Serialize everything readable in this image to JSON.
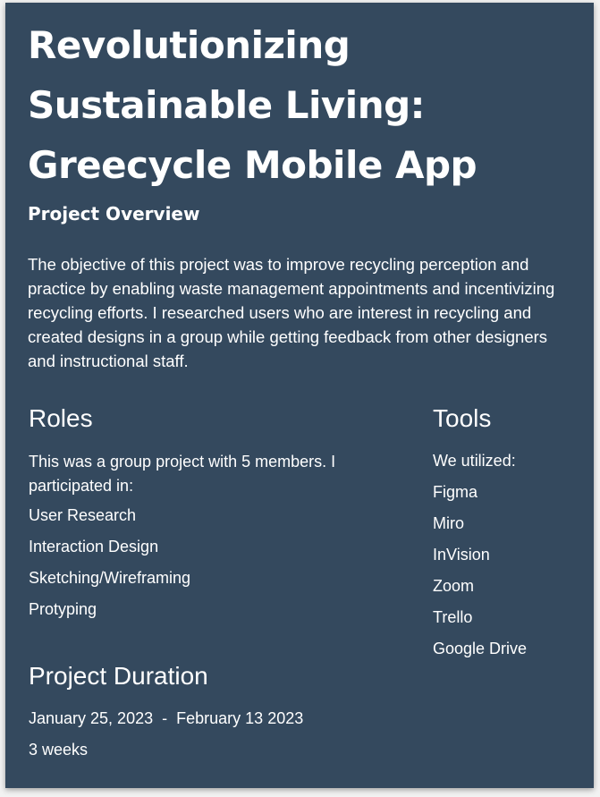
{
  "title": "Revolutionizing Sustainable Living: Greecycle Mobile App",
  "overview": {
    "heading": "Project Overview",
    "text": "The objective of this project was to improve recycling perception and practice by enabling waste management appointments and incentivizing recycling efforts. I researched users who are interest in recycling and created designs in a group while getting feedback from other designers and instructional staff."
  },
  "roles": {
    "heading": "Roles",
    "intro": "This was a group project with 5 members. I participated in:",
    "items": [
      "User Research",
      "Interaction Design",
      "Sketching/Wireframing",
      "Protyping"
    ]
  },
  "tools": {
    "heading": "Tools",
    "intro": "We utilized:",
    "items": [
      "Figma",
      "Miro",
      "InVision",
      "Zoom",
      "Trello",
      "Google Drive"
    ]
  },
  "duration": {
    "heading": "Project Duration",
    "start": "January 25, 2023",
    "separator": "-",
    "end": "February 13 2023",
    "length": "3 weeks"
  },
  "colors": {
    "card_background": "#34495e",
    "text": "#ffffff"
  }
}
